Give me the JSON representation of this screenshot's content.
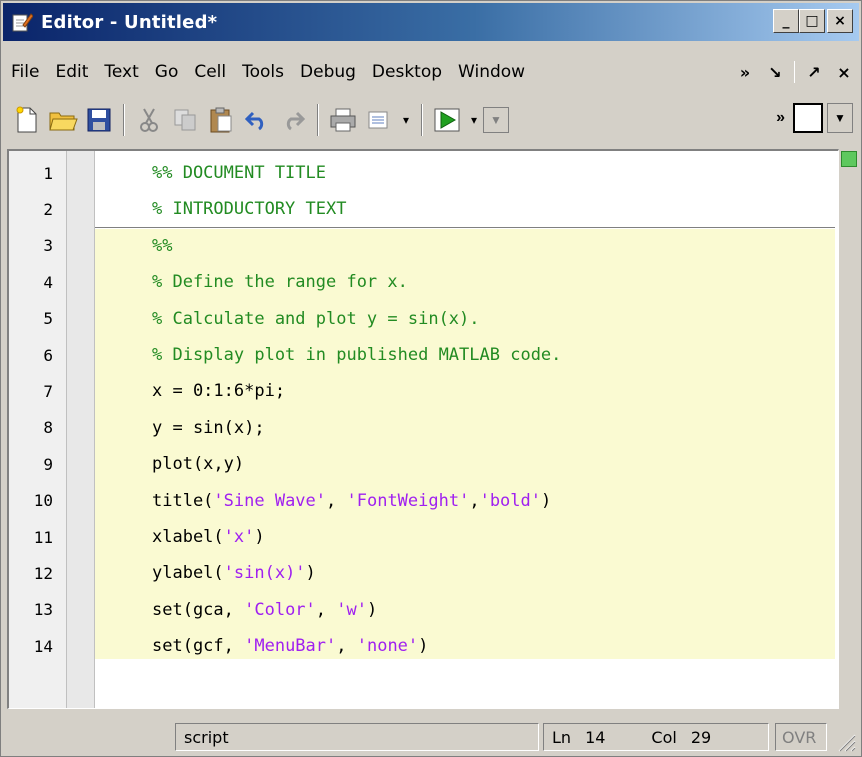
{
  "window": {
    "title": "Editor - Untitled*",
    "controls": {
      "minimize": "_",
      "maximize": "□",
      "close": "×"
    }
  },
  "menu": {
    "items": [
      "File",
      "Edit",
      "Text",
      "Go",
      "Cell",
      "Tools",
      "Debug",
      "Desktop",
      "Window"
    ],
    "right": {
      "more": "»",
      "dock": "↘",
      "undock": "↗",
      "close": "×"
    }
  },
  "toolbar": {
    "icons": [
      "new-file-icon",
      "open-folder-icon",
      "save-icon",
      "cut-icon",
      "copy-icon",
      "paste-icon",
      "undo-icon",
      "redo-icon",
      "print-icon",
      "find-icon",
      "run-icon"
    ],
    "more": "»"
  },
  "editor": {
    "lines": [
      {
        "n": "1",
        "parts": [
          {
            "t": "%% DOCUMENT TITLE",
            "k": "comment"
          }
        ]
      },
      {
        "n": "2",
        "parts": [
          {
            "t": "% INTRODUCTORY TEXT",
            "k": "comment"
          }
        ]
      },
      {
        "n": "3",
        "parts": [
          {
            "t": "%%",
            "k": "comment"
          }
        ]
      },
      {
        "n": "4",
        "parts": [
          {
            "t": "% Define the range for x.",
            "k": "comment"
          }
        ]
      },
      {
        "n": "5",
        "parts": [
          {
            "t": "% Calculate and plot y = sin(x).",
            "k": "comment"
          }
        ]
      },
      {
        "n": "6",
        "parts": [
          {
            "t": "% Display plot in published MATLAB code.",
            "k": "comment"
          }
        ]
      },
      {
        "n": "7",
        "parts": [
          {
            "t": "x = 0:1:6*pi;",
            "k": "code"
          }
        ]
      },
      {
        "n": "8",
        "parts": [
          {
            "t": "y = sin(x);",
            "k": "code"
          }
        ]
      },
      {
        "n": "9",
        "parts": [
          {
            "t": "plot(x,y)",
            "k": "code"
          }
        ]
      },
      {
        "n": "10",
        "parts": [
          {
            "t": "title(",
            "k": "code"
          },
          {
            "t": "'Sine Wave'",
            "k": "string"
          },
          {
            "t": ", ",
            "k": "code"
          },
          {
            "t": "'FontWeight'",
            "k": "string"
          },
          {
            "t": ",",
            "k": "code"
          },
          {
            "t": "'bold'",
            "k": "string"
          },
          {
            "t": ")",
            "k": "code"
          }
        ]
      },
      {
        "n": "11",
        "parts": [
          {
            "t": "xlabel(",
            "k": "code"
          },
          {
            "t": "'x'",
            "k": "string"
          },
          {
            "t": ")",
            "k": "code"
          }
        ]
      },
      {
        "n": "12",
        "parts": [
          {
            "t": "ylabel(",
            "k": "code"
          },
          {
            "t": "'sin(x)'",
            "k": "string"
          },
          {
            "t": ")",
            "k": "code"
          }
        ]
      },
      {
        "n": "13",
        "parts": [
          {
            "t": "set(gca, ",
            "k": "code"
          },
          {
            "t": "'Color'",
            "k": "string"
          },
          {
            "t": ", ",
            "k": "code"
          },
          {
            "t": "'w'",
            "k": "string"
          },
          {
            "t": ")",
            "k": "code"
          }
        ]
      },
      {
        "n": "14",
        "parts": [
          {
            "t": "set(gcf, ",
            "k": "code"
          },
          {
            "t": "'MenuBar'",
            "k": "string"
          },
          {
            "t": ", ",
            "k": "code"
          },
          {
            "t": "'none'",
            "k": "string"
          },
          {
            "t": ")",
            "k": "code"
          }
        ]
      }
    ],
    "colors": {
      "comment": "#228b22",
      "string": "#a020f0",
      "cell_highlight": "#fafad2"
    }
  },
  "status": {
    "mode": "script",
    "ln_label": "Ln",
    "ln_value": "14",
    "col_label": "Col",
    "col_value": "29",
    "ovr": "OVR"
  }
}
